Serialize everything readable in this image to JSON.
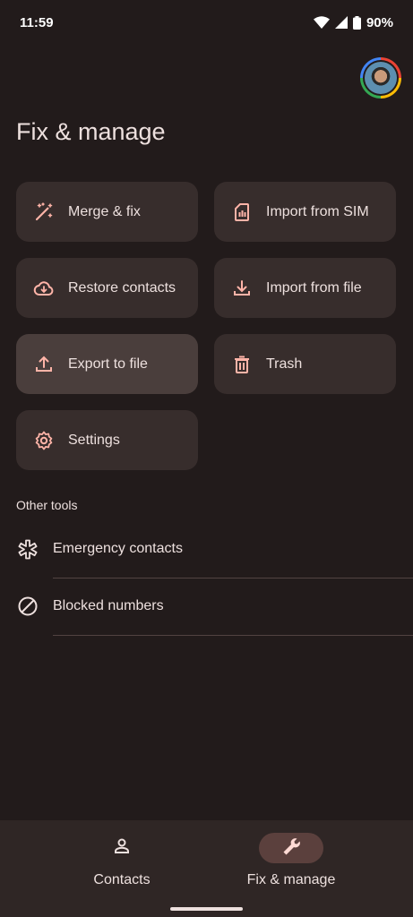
{
  "status": {
    "time": "11:59",
    "battery": "90%",
    "icons": [
      "wifi-icon",
      "signal-icon",
      "battery-icon"
    ]
  },
  "header": {
    "title": "Fix & manage",
    "avatar": "account-avatar"
  },
  "tiles": [
    {
      "label": "Merge & fix",
      "icon": "magic-wand-icon"
    },
    {
      "label": "Import from SIM",
      "icon": "sim-card-icon"
    },
    {
      "label": "Restore contacts",
      "icon": "cloud-restore-icon"
    },
    {
      "label": "Import from file",
      "icon": "download-icon"
    },
    {
      "label": "Export to file",
      "icon": "upload-icon"
    },
    {
      "label": "Trash",
      "icon": "trash-icon"
    },
    {
      "label": "Settings",
      "icon": "gear-icon"
    }
  ],
  "other_tools": {
    "label": "Other tools",
    "items": [
      {
        "label": "Emergency contacts",
        "icon": "emergency-icon"
      },
      {
        "label": "Blocked numbers",
        "icon": "block-icon"
      }
    ]
  },
  "bottom_nav": {
    "items": [
      {
        "label": "Contacts",
        "icon": "person-icon",
        "active": false
      },
      {
        "label": "Fix & manage",
        "icon": "wrench-icon",
        "active": true
      }
    ]
  },
  "colors": {
    "background": "#221b1b",
    "tile": "#372d2c",
    "accent_icon": "#ffb4a8",
    "nav_active": "#5b403d"
  }
}
